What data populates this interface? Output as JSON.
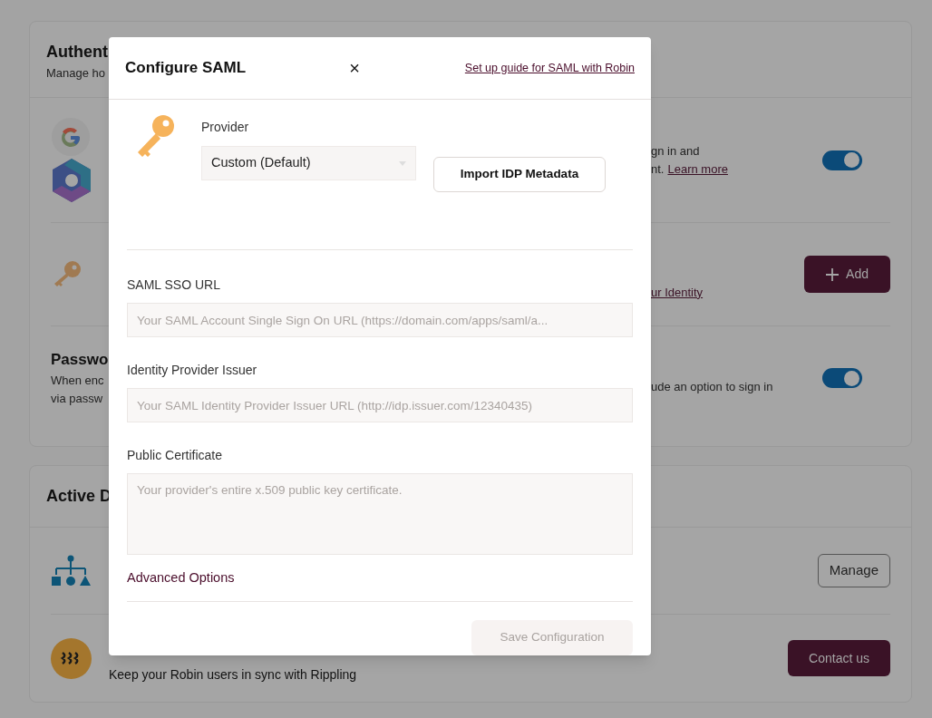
{
  "background": {
    "auth_card": {
      "title": "Authent",
      "subtitle": "Manage ho",
      "rows": [
        {
          "kind": "sso",
          "right_lines": [
            {
              "text": "gn in and"
            },
            {
              "text": "nt.",
              "link": "Learn more"
            }
          ],
          "control": {
            "kind": "toggle",
            "on": true
          }
        },
        {
          "kind": "saml",
          "right_lines": [
            {
              "link": "ur Identity"
            }
          ],
          "control": {
            "kind": "add",
            "label": "Add"
          }
        },
        {
          "kind": "password",
          "title": "Passwo",
          "left_lines": [
            "When enc",
            "via passw"
          ],
          "right_lines": [
            {
              "text": "ude an option to sign in"
            }
          ],
          "control": {
            "kind": "toggle",
            "on": true
          }
        }
      ]
    },
    "directory_card": {
      "title": "Active D",
      "rows": [
        {
          "kind": "scim",
          "control": {
            "kind": "outline",
            "label": "Manage"
          }
        },
        {
          "kind": "rippling",
          "description": "Keep your Robin users in sync with Rippling",
          "control": {
            "kind": "solid",
            "label": "Contact us"
          }
        }
      ]
    }
  },
  "modal": {
    "title": "Configure SAML",
    "close": "×",
    "guide_link": "Set up guide for SAML with Robin",
    "provider": {
      "label": "Provider",
      "value": "Custom (Default)"
    },
    "import_button": "Import IDP Metadata",
    "fields": [
      {
        "kind": "input",
        "label": "SAML SSO URL",
        "placeholder": "Your SAML Account Single Sign On URL (https://domain.com/apps/saml/a..."
      },
      {
        "kind": "input",
        "label": "Identity Provider Issuer",
        "placeholder": "Your SAML Identity Provider Issuer URL (http://idp.issuer.com/12340435)"
      },
      {
        "kind": "textarea",
        "label": "Public Certificate",
        "placeholder": "Your provider's entire x.509 public key certificate."
      }
    ],
    "advanced": "Advanced Options",
    "save": {
      "label": "Save Configuration",
      "disabled": true
    }
  }
}
